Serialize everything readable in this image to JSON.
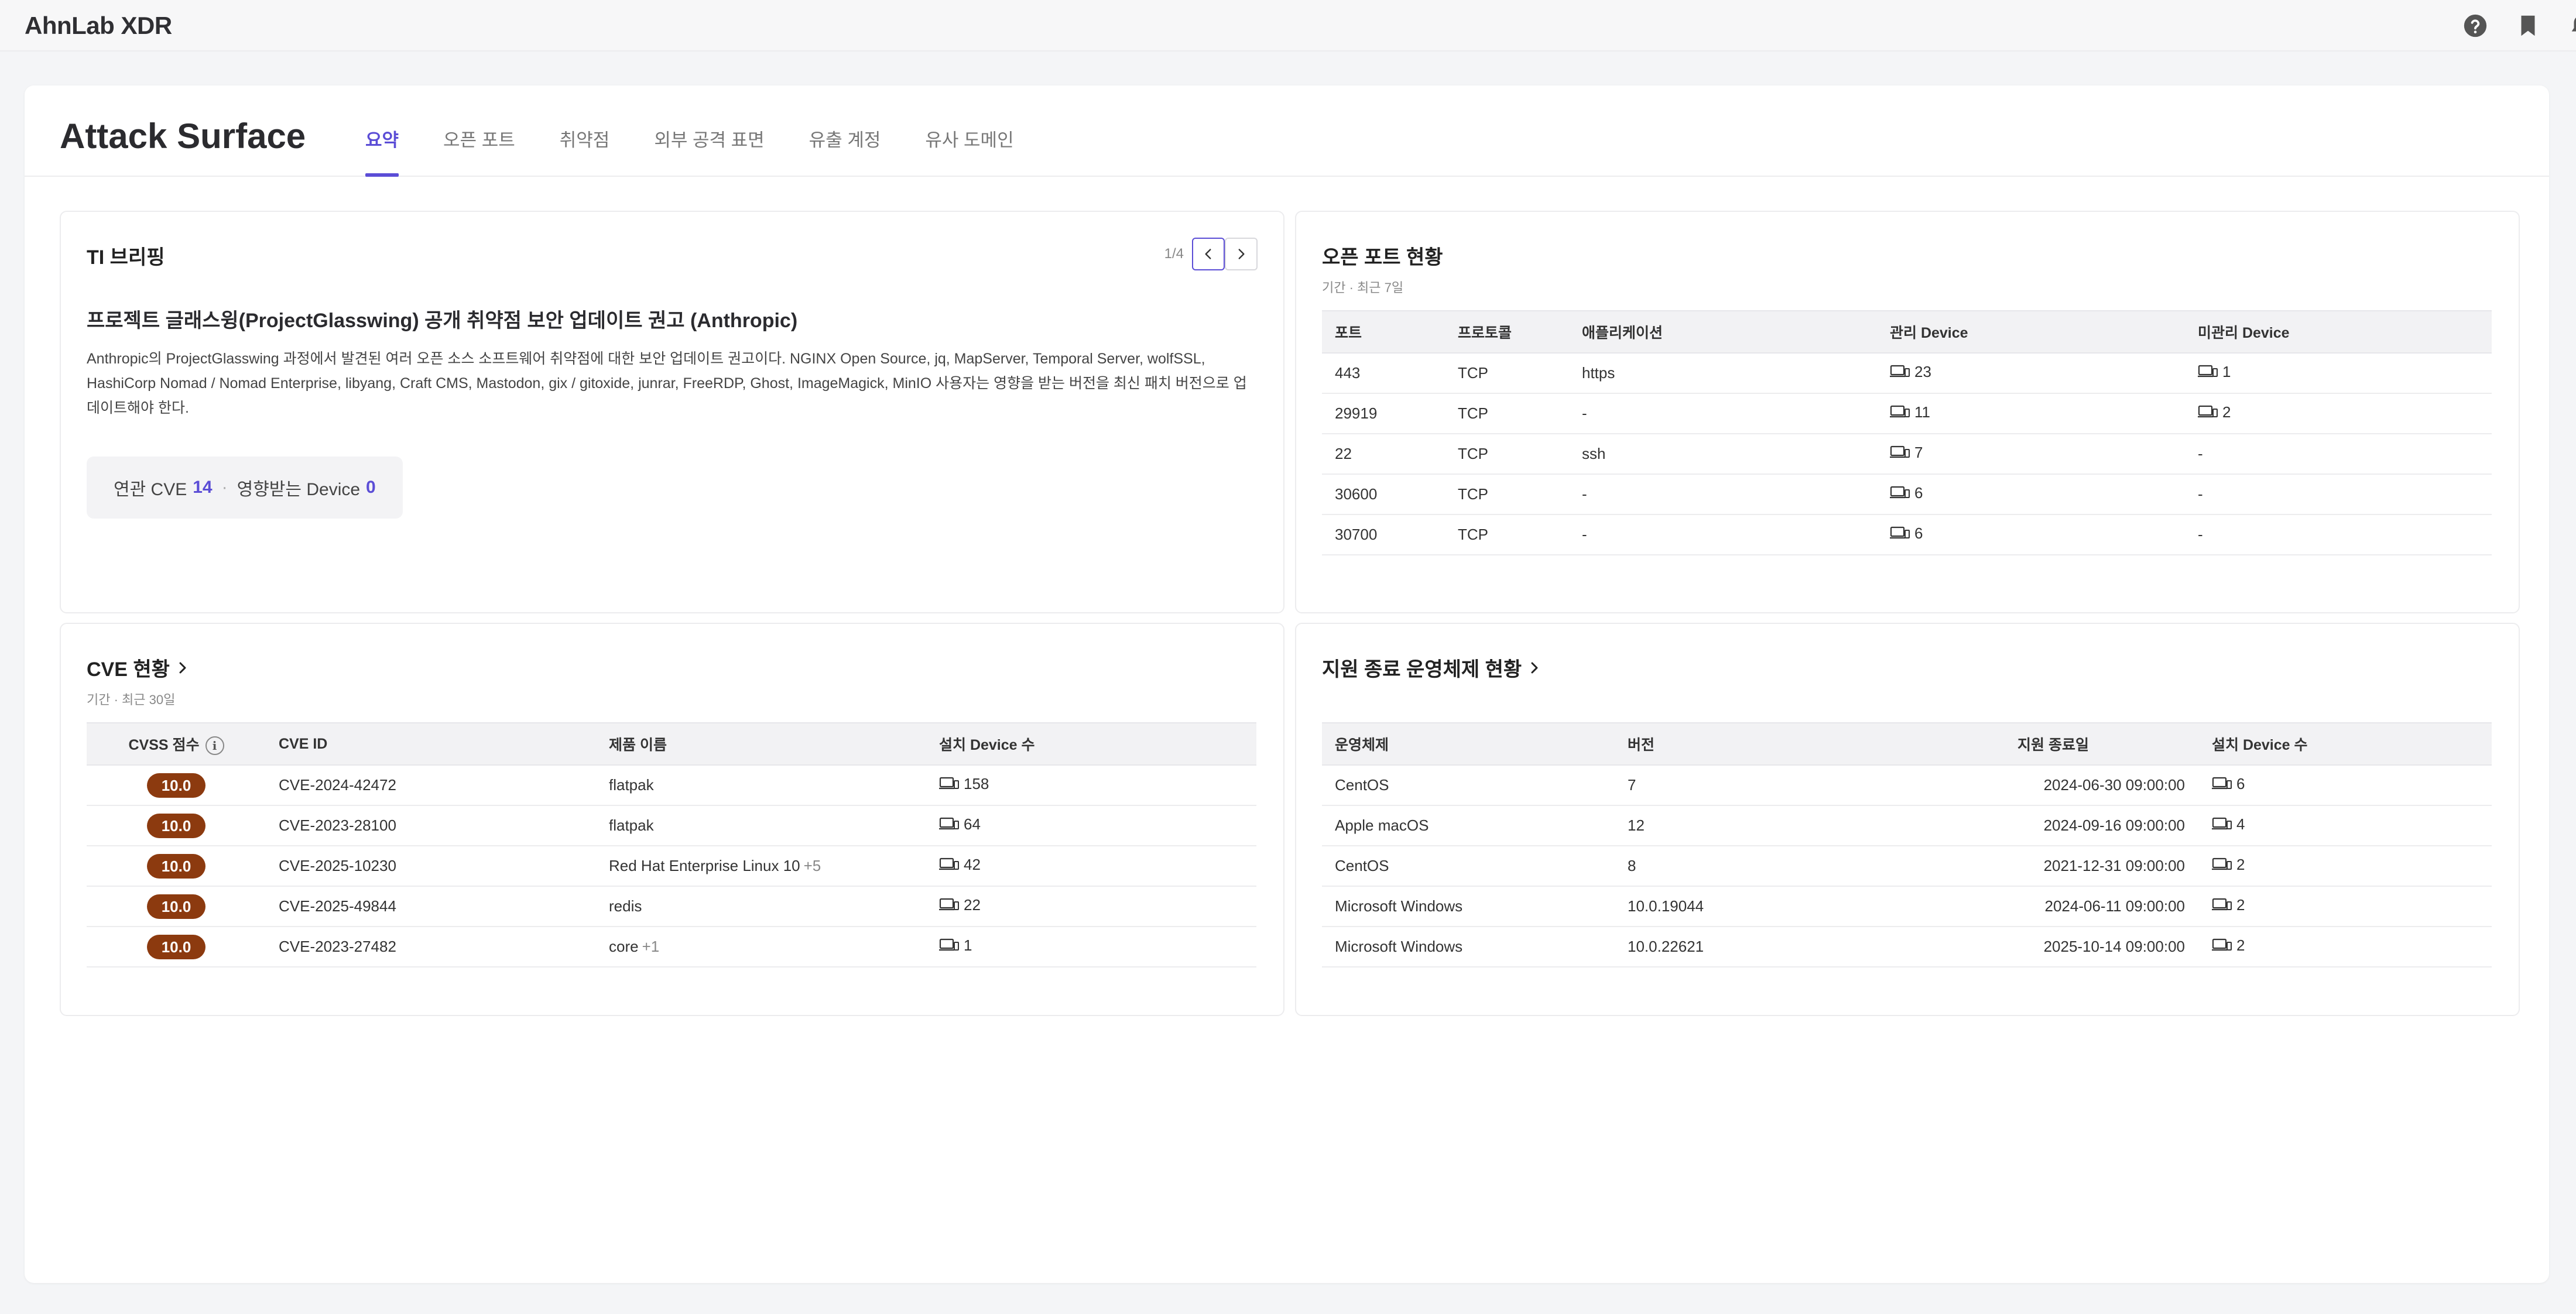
{
  "app": {
    "logo": "AhnLab XDR"
  },
  "header_icons": [
    "help-icon",
    "bookmark-icon",
    "bell-icon",
    "user-icon"
  ],
  "page": {
    "title": "Attack Surface",
    "tabs": [
      {
        "label": "요약",
        "active": true
      },
      {
        "label": "오픈 포트",
        "active": false
      },
      {
        "label": "취약점",
        "active": false
      },
      {
        "label": "외부 공격 표면",
        "active": false
      },
      {
        "label": "유출 계정",
        "active": false
      },
      {
        "label": "유사 도메인",
        "active": false
      }
    ]
  },
  "ti_briefing": {
    "title": "TI 브리핑",
    "pager": "1/4",
    "headline": "프로젝트 글래스윙(ProjectGlasswing) 공개 취약점 보안 업데이트 권고 (Anthropic)",
    "body": "Anthropic의 ProjectGlasswing 과정에서 발견된 여러 오픈 소스 소프트웨어 취약점에 대한 보안 업데이트 권고이다. NGINX Open Source, jq, MapServer, Temporal Server, wolfSSL, HashiCorp Nomad / Nomad Enterprise, libyang, Craft CMS, Mastodon, gix / gitoxide, junrar, FreeRDP, Ghost, ImageMagick, MinIO 사용자는 영향을 받는 버전을 최신 패치 버전으로 업데이트해야 한다.",
    "related_cve_label": "연관 CVE",
    "related_cve_count": "14",
    "separator": "·",
    "affected_device_label": "영향받는 Device",
    "affected_device_count": "0"
  },
  "open_ports": {
    "title": "오픈 포트 현황",
    "period": "기간 · 최근 7일",
    "columns": [
      "포트",
      "프로토콜",
      "애플리케이션",
      "관리 Device",
      "미관리 Device"
    ],
    "rows": [
      {
        "port": "443",
        "protocol": "TCP",
        "app": "https",
        "managed": "23",
        "unmanaged": "1",
        "unmanaged_icon": true
      },
      {
        "port": "29919",
        "protocol": "TCP",
        "app": "-",
        "managed": "11",
        "unmanaged": "2",
        "unmanaged_icon": true
      },
      {
        "port": "22",
        "protocol": "TCP",
        "app": "ssh",
        "managed": "7",
        "unmanaged": "-",
        "unmanaged_icon": false
      },
      {
        "port": "30600",
        "protocol": "TCP",
        "app": "-",
        "managed": "6",
        "unmanaged": "-",
        "unmanaged_icon": false
      },
      {
        "port": "30700",
        "protocol": "TCP",
        "app": "-",
        "managed": "6",
        "unmanaged": "-",
        "unmanaged_icon": false
      }
    ]
  },
  "cve": {
    "title": "CVE 현황",
    "period": "기간 · 최근 30일",
    "columns": [
      "CVSS 점수",
      "CVE ID",
      "제품 이름",
      "설치 Device 수"
    ],
    "rows": [
      {
        "score": "10.0",
        "id": "CVE-2024-42472",
        "product": "flatpak",
        "extra": "",
        "devices": "158"
      },
      {
        "score": "10.0",
        "id": "CVE-2023-28100",
        "product": "flatpak",
        "extra": "",
        "devices": "64"
      },
      {
        "score": "10.0",
        "id": "CVE-2025-10230",
        "product": "Red Hat Enterprise Linux 10",
        "extra": "+5",
        "devices": "42"
      },
      {
        "score": "10.0",
        "id": "CVE-2025-49844",
        "product": "redis",
        "extra": "",
        "devices": "22"
      },
      {
        "score": "10.0",
        "id": "CVE-2023-27482",
        "product": "core",
        "extra": "+1",
        "devices": "1"
      }
    ],
    "badge_color": "#8c3a0f"
  },
  "eol_os": {
    "title": "지원 종료 운영체제 현황",
    "columns": [
      "운영체제",
      "버전",
      "지원 종료일",
      "설치 Device 수"
    ],
    "rows": [
      {
        "os": "CentOS",
        "version": "7",
        "eol": "2024-06-30 09:00:00",
        "devices": "6"
      },
      {
        "os": "Apple macOS",
        "version": "12",
        "eol": "2024-09-16 09:00:00",
        "devices": "4"
      },
      {
        "os": "CentOS",
        "version": "8",
        "eol": "2021-12-31 09:00:00",
        "devices": "2"
      },
      {
        "os": "Microsoft Windows",
        "version": "10.0.19044",
        "eol": "2024-06-11 09:00:00",
        "devices": "2"
      },
      {
        "os": "Microsoft Windows",
        "version": "10.0.22621",
        "eol": "2025-10-14 09:00:00",
        "devices": "2"
      }
    ]
  },
  "colors": {
    "accent": "#5b4dd6",
    "badge": "#8c3a0f"
  }
}
